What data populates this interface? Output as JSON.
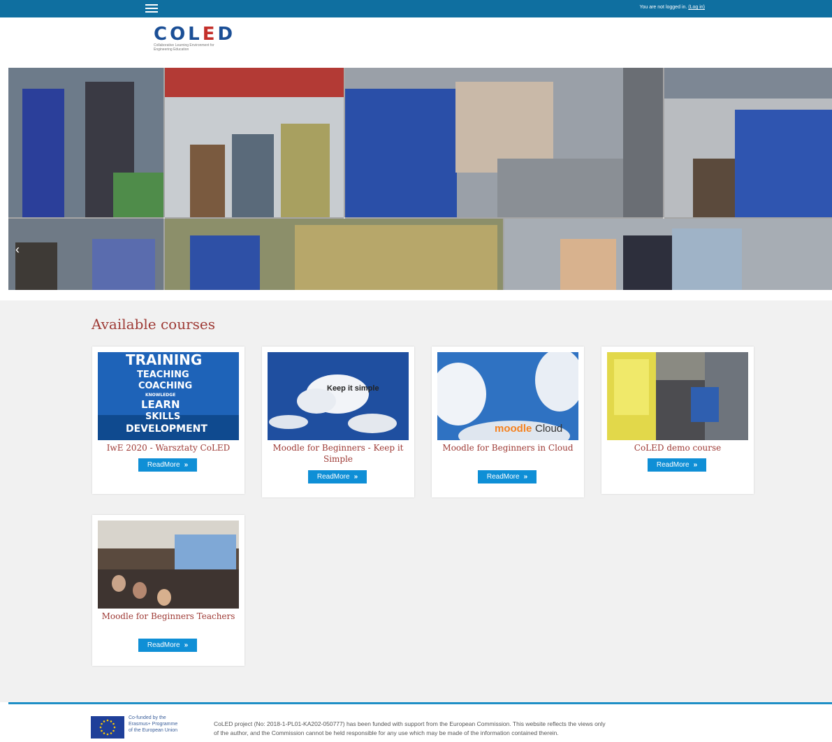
{
  "topbar": {
    "menu_icon": "hamburger-menu-icon",
    "login_text": "You are not logged in.",
    "login_link": "(Log in)",
    "bg_color": "#0f6fa0"
  },
  "logo": {
    "wordmark_blue": "COL",
    "wordmark_red": "E",
    "wordmark_end": "D",
    "tagline": "Collaborative Learning Environment for Engineering Education"
  },
  "slider": {
    "prev_icon": "chevron-left-icon",
    "prev_glyph": "‹"
  },
  "main": {
    "section_title": "Available courses",
    "courses": [
      {
        "title": "IwE 2020 - Warsztaty CoLED",
        "button": "ReadMore",
        "image": "training-words-image",
        "words": [
          "TRAINING",
          "TEACHING",
          "COACHING",
          "KNOWLEDGE",
          "LEARN",
          "SKILLS",
          "DEVELOPMENT"
        ]
      },
      {
        "title": "Moodle for Beginners - Keep it Simple",
        "button": "ReadMore",
        "image": "cloud-sky-image",
        "caption": "Keep it simple"
      },
      {
        "title": "Moodle for Beginners in Cloud",
        "button": "ReadMore",
        "image": "moodlecloud-image",
        "brand_a": "moodle",
        "brand_b": "Cloud"
      },
      {
        "title": "CoLED demo course",
        "button": "ReadMore",
        "image": "machine-image"
      },
      {
        "title": "Moodle for Beginners Teachers",
        "button": "ReadMore",
        "image": "lecture-hall-image"
      }
    ]
  },
  "footer": {
    "eu_line1": "Co-funded by the",
    "eu_line2": "Erasmus+ Programme",
    "eu_line3": "of the European Union",
    "text_line1": "CoLED project (No: 2018-1-PL01-KA202-050777) has been funded with support from the European Commission. This website reflects the views only",
    "text_line2": "of the author, and the Commission cannot be held responsible for any use which may be made of the information contained therein."
  },
  "colors": {
    "accent": "#0f8fd6",
    "heading": "#9e3a35",
    "footer_line": "#1e8fc6"
  }
}
